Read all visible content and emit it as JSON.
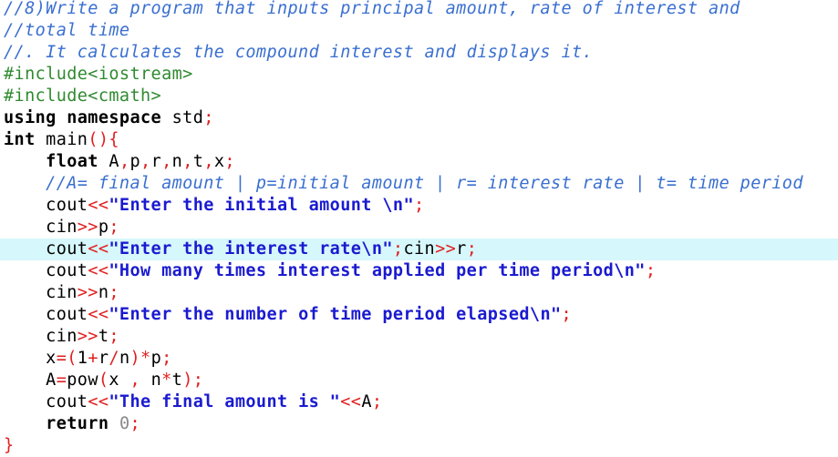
{
  "editor": {
    "lines": [
      {
        "tokens": [
          {
            "t": "cm",
            "v": "//8)Write a program that inputs principal amount, rate of interest and"
          }
        ]
      },
      {
        "tokens": [
          {
            "t": "cm",
            "v": "//total time"
          }
        ]
      },
      {
        "tokens": [
          {
            "t": "cm",
            "v": "//. It calculates the compound interest and displays it."
          }
        ]
      },
      {
        "tokens": [
          {
            "t": "pp",
            "v": "#include<iostream>"
          }
        ]
      },
      {
        "tokens": [
          {
            "t": "pp",
            "v": "#include<cmath>"
          }
        ]
      },
      {
        "tokens": [
          {
            "t": "kw",
            "v": "using namespace"
          },
          {
            "t": "pl",
            "v": " std"
          },
          {
            "t": "op",
            "v": ";"
          }
        ]
      },
      {
        "tokens": [
          {
            "t": "kw",
            "v": "int"
          },
          {
            "t": "pl",
            "v": " main"
          },
          {
            "t": "op",
            "v": "(){"
          }
        ]
      },
      {
        "tokens": [
          {
            "t": "pl",
            "v": "    "
          },
          {
            "t": "kw",
            "v": "float"
          },
          {
            "t": "pl",
            "v": " A"
          },
          {
            "t": "op",
            "v": ","
          },
          {
            "t": "pl",
            "v": "p"
          },
          {
            "t": "op",
            "v": ","
          },
          {
            "t": "pl",
            "v": "r"
          },
          {
            "t": "op",
            "v": ","
          },
          {
            "t": "pl",
            "v": "n"
          },
          {
            "t": "op",
            "v": ","
          },
          {
            "t": "pl",
            "v": "t"
          },
          {
            "t": "op",
            "v": ","
          },
          {
            "t": "pl",
            "v": "x"
          },
          {
            "t": "op",
            "v": ";"
          }
        ]
      },
      {
        "tokens": [
          {
            "t": "pl",
            "v": "    "
          },
          {
            "t": "cm",
            "v": "//A= final amount | p=initial amount | r= interest rate | t= time period"
          }
        ]
      },
      {
        "tokens": [
          {
            "t": "pl",
            "v": "    cout"
          },
          {
            "t": "op",
            "v": "<<"
          },
          {
            "t": "st",
            "v": "\"Enter the initial amount \\n\""
          },
          {
            "t": "op",
            "v": ";"
          }
        ]
      },
      {
        "tokens": [
          {
            "t": "pl",
            "v": "    cin"
          },
          {
            "t": "op",
            "v": ">>"
          },
          {
            "t": "pl",
            "v": "p"
          },
          {
            "t": "op",
            "v": ";"
          }
        ]
      },
      {
        "highlight": true,
        "tokens": [
          {
            "t": "pl",
            "v": "    cout"
          },
          {
            "t": "op",
            "v": "<<"
          },
          {
            "t": "st",
            "v": "\"Enter the interest rate\\n\""
          },
          {
            "t": "op",
            "v": ";"
          },
          {
            "t": "pl",
            "v": "cin"
          },
          {
            "t": "op",
            "v": ">>"
          },
          {
            "t": "pl",
            "v": "r"
          },
          {
            "t": "op",
            "v": ";"
          }
        ]
      },
      {
        "tokens": [
          {
            "t": "pl",
            "v": "    cout"
          },
          {
            "t": "op",
            "v": "<<"
          },
          {
            "t": "st",
            "v": "\"How many times interest applied per time period\\n\""
          },
          {
            "t": "op",
            "v": ";"
          }
        ]
      },
      {
        "tokens": [
          {
            "t": "pl",
            "v": "    cin"
          },
          {
            "t": "op",
            "v": ">>"
          },
          {
            "t": "pl",
            "v": "n"
          },
          {
            "t": "op",
            "v": ";"
          }
        ]
      },
      {
        "tokens": [
          {
            "t": "pl",
            "v": "    cout"
          },
          {
            "t": "op",
            "v": "<<"
          },
          {
            "t": "st",
            "v": "\"Enter the number of time period elapsed\\n\""
          },
          {
            "t": "op",
            "v": ";"
          }
        ]
      },
      {
        "tokens": [
          {
            "t": "pl",
            "v": "    cin"
          },
          {
            "t": "op",
            "v": ">>"
          },
          {
            "t": "pl",
            "v": "t"
          },
          {
            "t": "op",
            "v": ";"
          }
        ]
      },
      {
        "tokens": [
          {
            "t": "pl",
            "v": "    x"
          },
          {
            "t": "op",
            "v": "=("
          },
          {
            "t": "pl",
            "v": "1"
          },
          {
            "t": "op",
            "v": "+"
          },
          {
            "t": "pl",
            "v": "r"
          },
          {
            "t": "op",
            "v": "/"
          },
          {
            "t": "pl",
            "v": "n"
          },
          {
            "t": "op",
            "v": ")*"
          },
          {
            "t": "pl",
            "v": "p"
          },
          {
            "t": "op",
            "v": ";"
          }
        ]
      },
      {
        "tokens": [
          {
            "t": "pl",
            "v": "    A"
          },
          {
            "t": "op",
            "v": "="
          },
          {
            "t": "pl",
            "v": "pow"
          },
          {
            "t": "op",
            "v": "("
          },
          {
            "t": "pl",
            "v": "x "
          },
          {
            "t": "op",
            "v": ","
          },
          {
            "t": "pl",
            "v": " n"
          },
          {
            "t": "op",
            "v": "*"
          },
          {
            "t": "pl",
            "v": "t"
          },
          {
            "t": "op",
            "v": ");"
          }
        ]
      },
      {
        "tokens": [
          {
            "t": "pl",
            "v": "    cout"
          },
          {
            "t": "op",
            "v": "<<"
          },
          {
            "t": "st",
            "v": "\"The final amount is \""
          },
          {
            "t": "op",
            "v": "<<"
          },
          {
            "t": "pl",
            "v": "A"
          },
          {
            "t": "op",
            "v": ";"
          }
        ]
      },
      {
        "tokens": [
          {
            "t": "pl",
            "v": "    "
          },
          {
            "t": "kw",
            "v": "return"
          },
          {
            "t": "pl",
            "v": " "
          },
          {
            "t": "nm",
            "v": "0"
          },
          {
            "t": "op",
            "v": ";"
          }
        ]
      },
      {
        "tokens": [
          {
            "t": "op",
            "v": "}"
          }
        ]
      }
    ]
  },
  "colors": {
    "comment": "#3a6fd0",
    "preprocessor": "#2f8a2f",
    "keyword": "#000000",
    "operator": "#e02020",
    "string": "#1a1ad0",
    "number": "#8a8a8a",
    "current_line": "#d6f7fb"
  }
}
